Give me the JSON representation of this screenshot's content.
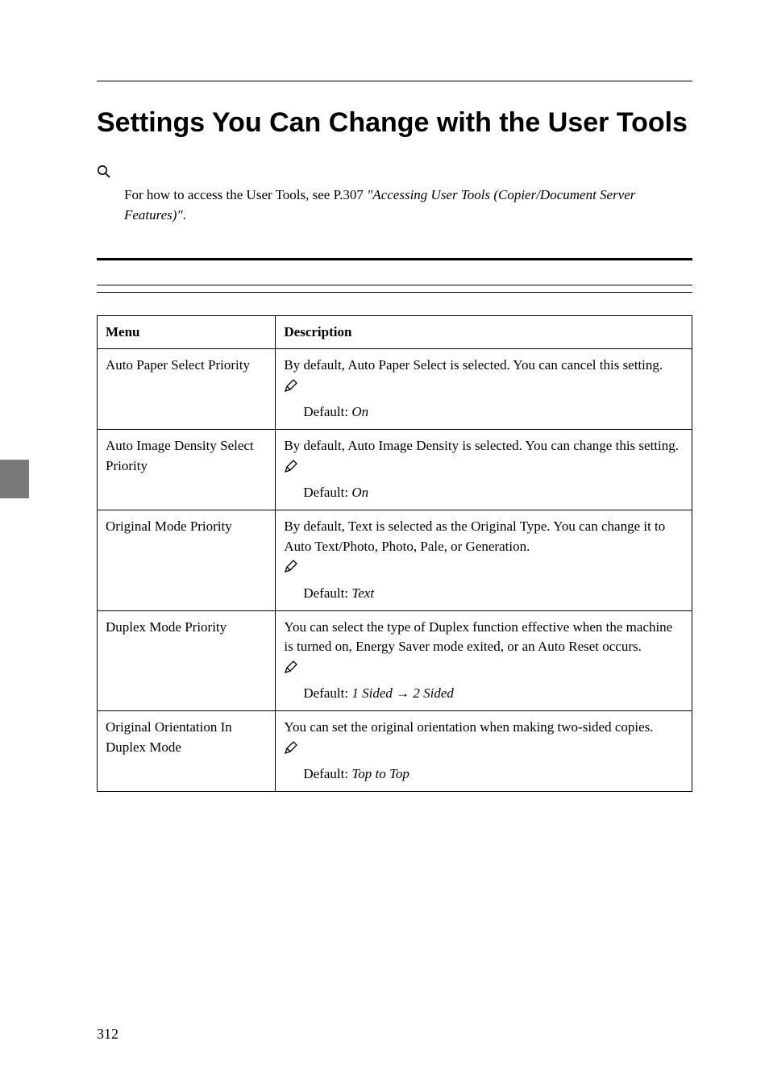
{
  "title": "Settings You Can Change with the User Tools",
  "reference": {
    "lead": "For how to access the User Tools, see ",
    "page_ref": "P.307 ",
    "italic_part": "\"Accessing User Tools (Copier/Document Server Features)\"",
    "tail": "."
  },
  "table": {
    "headers": {
      "menu": "Menu",
      "description": "Description"
    },
    "rows": [
      {
        "menu": "Auto Paper Select Priority",
        "desc": "By default, Auto Paper Select is selected. You can cancel this setting.",
        "default_prefix": "Default: ",
        "default_value": "On"
      },
      {
        "menu": "Auto Image Density Select Priority",
        "desc": "By default, Auto Image Density is selected. You can change this setting.",
        "default_prefix": "Default: ",
        "default_value": "On"
      },
      {
        "menu": "Original Mode Priority",
        "desc": "By default, Text is selected as the Original Type. You can change it to Auto Text/Photo, Photo, Pale, or Generation.",
        "default_prefix": "Default: ",
        "default_value": "Text"
      },
      {
        "menu": "Duplex Mode Priority",
        "desc": "You can select the type of Duplex function effective when the machine is turned on, Energy Saver mode exited, or an Auto Reset occurs.",
        "default_prefix": "Default: ",
        "default_value": "1 Sided → 2 Sided"
      },
      {
        "menu": "Original Orientation In Duplex Mode",
        "desc": "You can set the original orientation when making two-sided copies.",
        "default_prefix": "Default: ",
        "default_value": "Top to Top"
      }
    ]
  },
  "page_number": "312"
}
